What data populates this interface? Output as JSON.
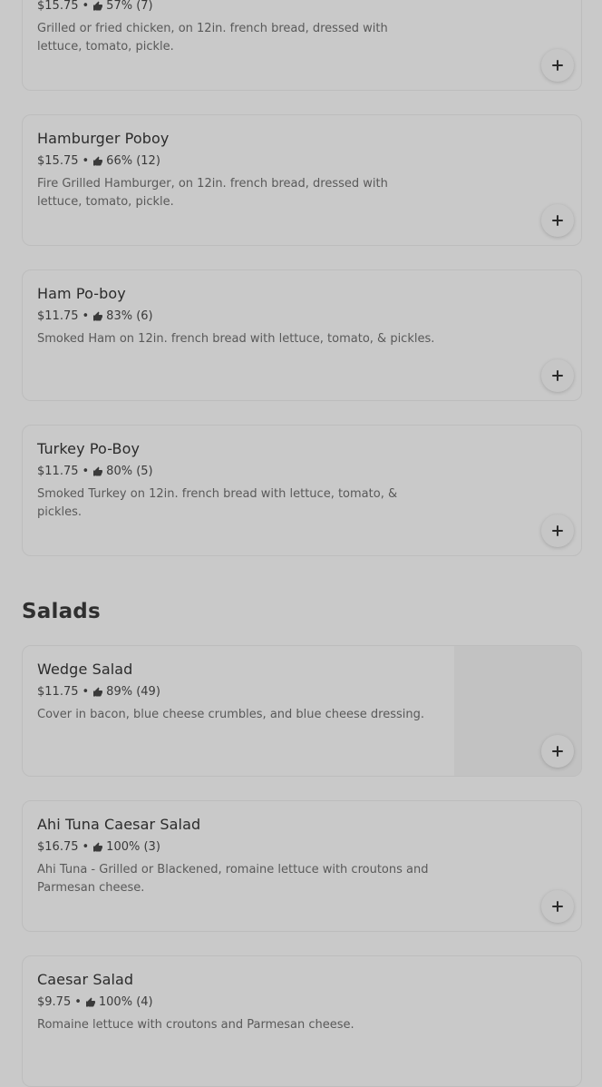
{
  "sections": [
    {
      "items": [
        {
          "name": "",
          "price": "$15.75",
          "rating": "57% (7)",
          "description": "Grilled or fried chicken, on 12in. french bread, dressed with lettuce, tomato, pickle."
        },
        {
          "name": "Hamburger Poboy",
          "price": "$15.75",
          "rating": "66% (12)",
          "description": "Fire Grilled Hamburger, on 12in. french bread, dressed with lettuce, tomato, pickle."
        },
        {
          "name": "Ham Po-boy",
          "price": "$11.75",
          "rating": "83% (6)",
          "description": "Smoked Ham on 12in. french bread with lettuce, tomato, & pickles."
        },
        {
          "name": "Turkey Po-Boy",
          "price": "$11.75",
          "rating": "80% (5)",
          "description": "Smoked Turkey on 12in. french bread with lettuce, tomato, & pickles."
        }
      ]
    },
    {
      "title": "Salads",
      "items": [
        {
          "name": "Wedge Salad",
          "price": "$11.75",
          "rating": "89% (49)",
          "description": "Cover in bacon, blue cheese crumbles, and blue cheese dressing."
        },
        {
          "name": "Ahi Tuna Caesar Salad",
          "price": "$16.75",
          "rating": "100% (3)",
          "description": "Ahi Tuna - Grilled or Blackened, romaine lettuce with croutons and Parmesan cheese."
        },
        {
          "name": "Caesar Salad",
          "price": "$9.75",
          "rating": "100% (4)",
          "description": "Romaine lettuce with croutons and Parmesan cheese."
        }
      ]
    }
  ],
  "meta_separator": "•",
  "icons": {
    "rating": "thumbs-up-icon",
    "add": "plus-icon"
  }
}
